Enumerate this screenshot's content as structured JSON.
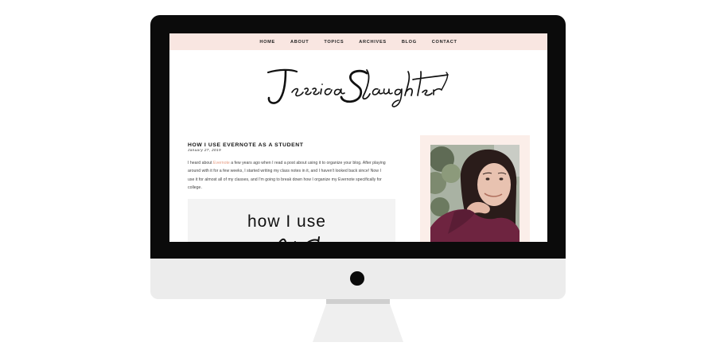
{
  "nav": {
    "items": [
      "HOME",
      "ABOUT",
      "TOPICS",
      "ARCHIVES",
      "BLOG",
      "CONTACT"
    ]
  },
  "site": {
    "logo_text": "Jessica Slaughter"
  },
  "post": {
    "title": "HOW I USE EVERNOTE AS A STUDENT",
    "date": "January 27, 2019",
    "body_prefix": "I heard about ",
    "body_link": "Evernote",
    "body_rest": " a few years ago when I read a post about using it to organize your blog. After playing around with it for a few weeks, I started writing my class notes in it, and I haven't looked back since! Now I use it for almost all of my classes, and I'm going to break down how I organize my Evernote specifically for college.",
    "featured_image_text": "how I use"
  },
  "colors": {
    "nav_bg": "#f9e6e1",
    "link_accent": "#e69a80",
    "sidebar_frame": "#fbeee9",
    "monitor_bezel": "#0b0b0b",
    "monitor_chin": "#ececec"
  },
  "icons": {
    "camera": "camera-dot-icon"
  }
}
